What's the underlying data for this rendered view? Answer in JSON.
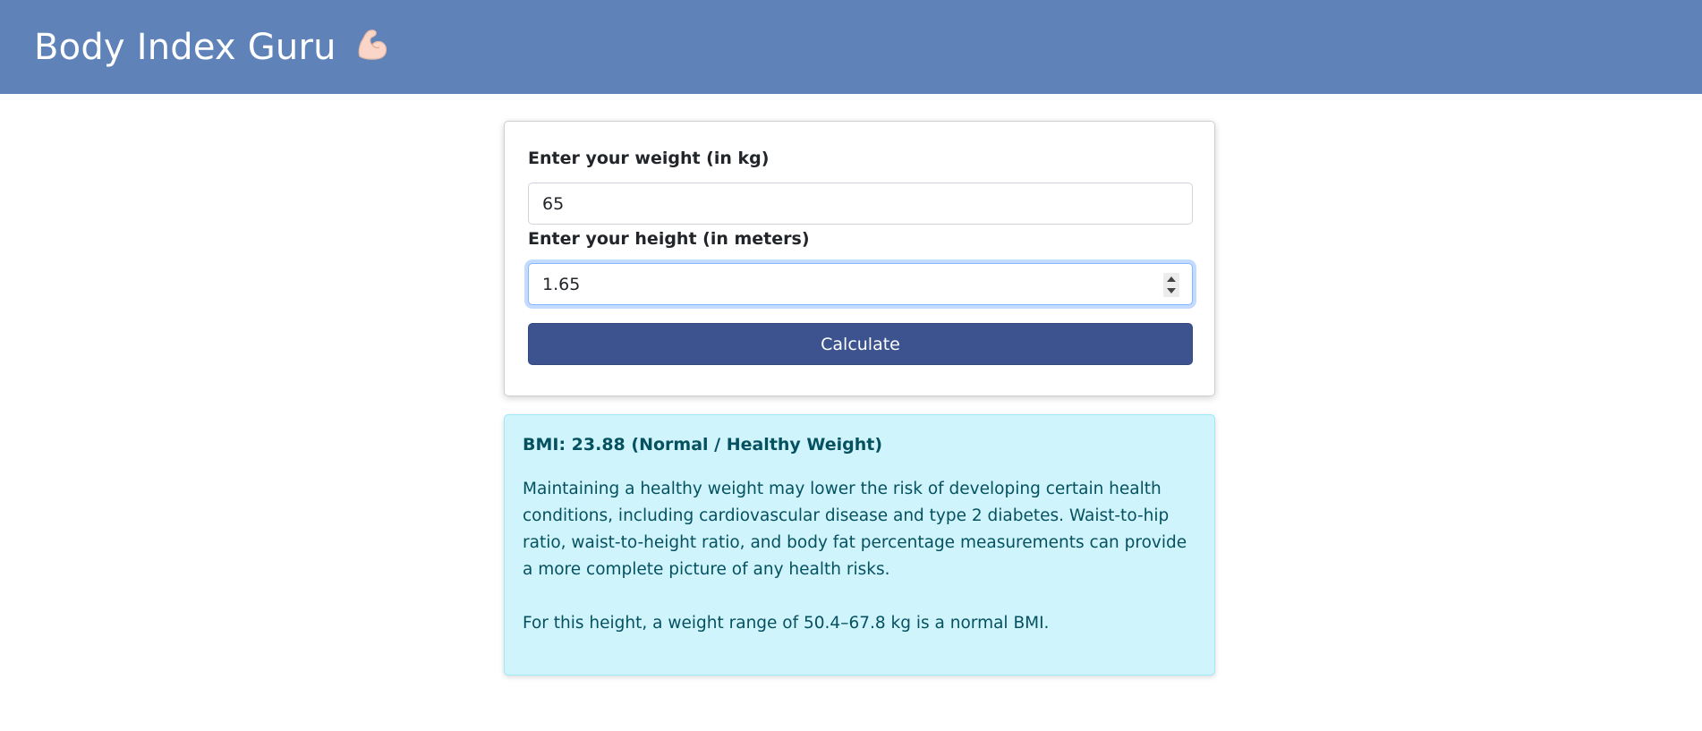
{
  "header": {
    "brand": "Body Index Guru"
  },
  "icons": {
    "brand_icon": "flexed-biceps-icon"
  },
  "colors": {
    "navbar": "#5f83b9",
    "button": "#3c538f",
    "result_bg": "#cff4fc",
    "result_text": "#055160"
  },
  "form": {
    "weight_label": "Enter your weight (in kg)",
    "weight_value": "65",
    "height_label": "Enter your height (in meters)",
    "height_value": "1.65",
    "calculate_label": "Calculate"
  },
  "result": {
    "title": "BMI: 23.88 (Normal / Healthy Weight)",
    "description": "Maintaining a healthy weight may lower the risk of developing certain health conditions, including cardiovascular disease and type 2 diabetes. Waist-to-hip ratio, waist-to-height ratio, and body fat percentage measurements can provide a more complete picture of any health risks.",
    "range_text": "For this height, a weight range of 50.4–67.8 kg is a normal BMI."
  }
}
